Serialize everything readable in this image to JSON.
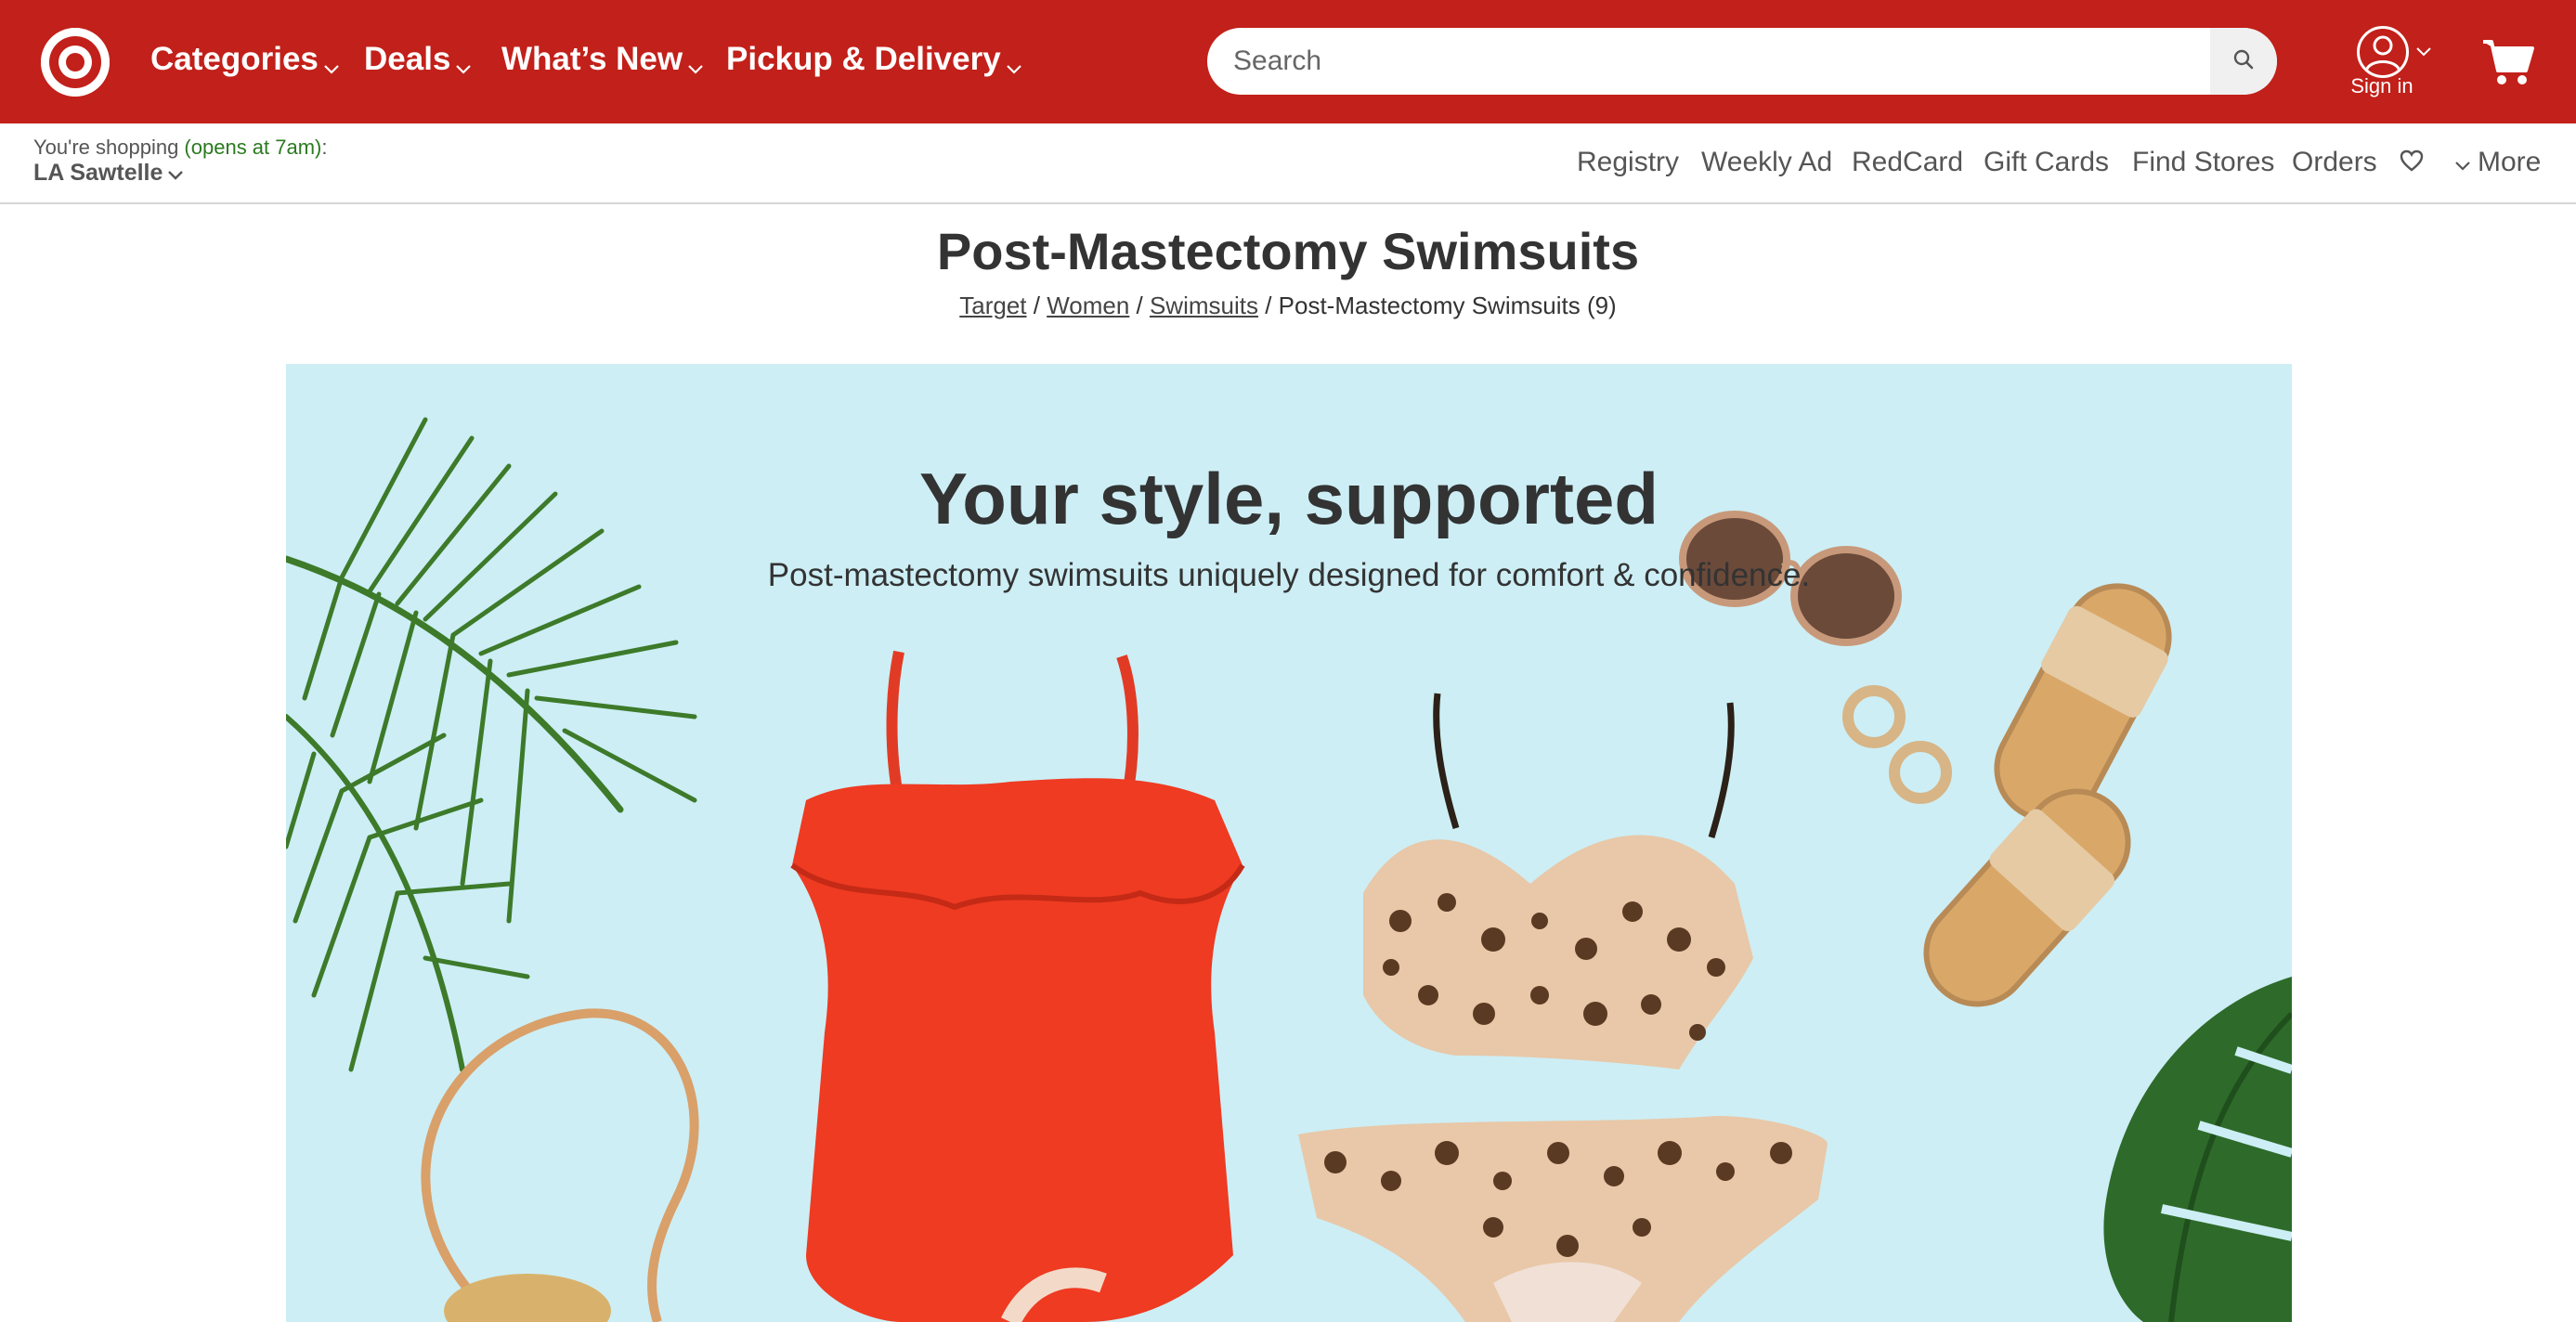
{
  "header": {
    "brand": "Target",
    "brand_color": "#c2201a",
    "nav": [
      {
        "label": "Categories",
        "icon": "chevron-down-icon"
      },
      {
        "label": "Deals",
        "icon": "chevron-down-icon"
      },
      {
        "label": "What’s New",
        "icon": "chevron-down-icon"
      },
      {
        "label": "Pickup & Delivery",
        "icon": "chevron-down-icon"
      }
    ],
    "search": {
      "placeholder": "Search",
      "value": "",
      "icon": "search-icon"
    },
    "account": {
      "label": "Sign in",
      "icon": "account-icon"
    },
    "cart": {
      "icon": "cart-icon"
    }
  },
  "subbar": {
    "store_prefix": "You're shopping ",
    "store_hours": "(opens at 7am)",
    "store_suffix": ":",
    "store_name": "LA Sawtelle",
    "links": [
      "Registry",
      "Weekly Ad",
      "RedCard",
      "Gift Cards",
      "Find Stores",
      "Orders"
    ],
    "heart_icon": "heart-icon",
    "more_label": "More"
  },
  "page": {
    "title": "Post-Mastectomy Swimsuits",
    "breadcrumb": {
      "items": [
        "Target",
        "Women",
        "Swimsuits"
      ],
      "separator": " / ",
      "current": "Post-Mastectomy Swimsuits (9)"
    }
  },
  "hero": {
    "title": "Your style, supported",
    "subtitle": "Post-mastectomy swimsuits uniquely designed for comfort & confidence.",
    "background_color": "#cdeef5"
  }
}
